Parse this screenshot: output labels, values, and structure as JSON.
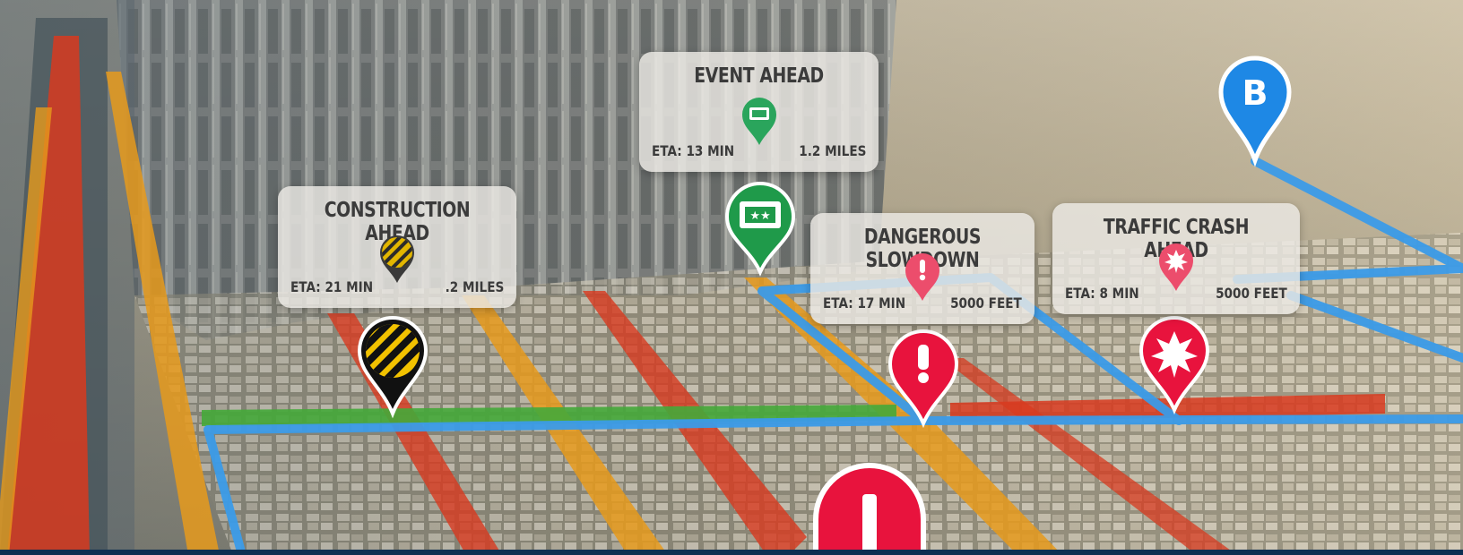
{
  "alerts": [
    {
      "id": "construction",
      "title": "CONSTRUCTION AHEAD",
      "eta": "ETA: 21 MIN",
      "distance": ".2 MILES",
      "icon": "hazard-stripes-icon",
      "color": "#f2c200"
    },
    {
      "id": "event",
      "title": "EVENT AHEAD",
      "eta": "ETA: 13 MIN",
      "distance": "1.2 MILES",
      "icon": "ticket-icon",
      "color": "#1f9a4a"
    },
    {
      "id": "slowdown",
      "title": "DANGEROUS SLOWDOWN",
      "eta": "ETA: 17 MIN",
      "distance": "5000 FEET",
      "icon": "exclamation-icon",
      "color": "#e8133d"
    },
    {
      "id": "crash",
      "title": "TRAFFIC CRASH AHEAD",
      "eta": "ETA: 8 MIN",
      "distance": "5000 FEET",
      "icon": "crash-burst-icon",
      "color": "#e8133d"
    }
  ],
  "destination": {
    "label": "B",
    "color": "#1e88e5"
  },
  "route_colors": {
    "route": "#3b9be8",
    "heavy": "#d83a1f",
    "moderate": "#e69a1c",
    "clear": "#45a83a"
  }
}
